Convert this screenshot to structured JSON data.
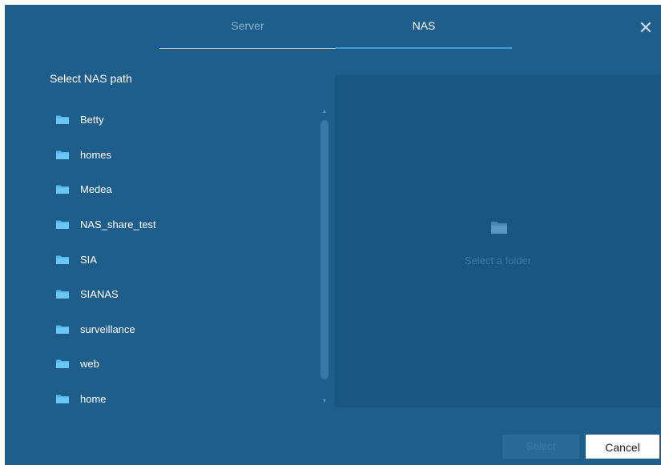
{
  "tabs": [
    {
      "label": "Server",
      "active": false
    },
    {
      "label": "NAS",
      "active": true
    }
  ],
  "close_icon": "close-icon",
  "left_panel": {
    "title": "Select NAS path",
    "folders": [
      {
        "label": "Betty",
        "icon": "folder-icon"
      },
      {
        "label": "homes",
        "icon": "folder-icon"
      },
      {
        "label": "Medea",
        "icon": "folder-icon"
      },
      {
        "label": "NAS_share_test",
        "icon": "folder-icon"
      },
      {
        "label": "SIA",
        "icon": "folder-icon"
      },
      {
        "label": "SIANAS",
        "icon": "folder-icon"
      },
      {
        "label": "surveillance",
        "icon": "folder-icon"
      },
      {
        "label": "web",
        "icon": "folder-icon"
      },
      {
        "label": "home",
        "icon": "folder-icon"
      }
    ]
  },
  "right_panel": {
    "empty_icon": "folder-open-icon",
    "empty_text": "Select a folder"
  },
  "footer": {
    "select_label": "Select",
    "cancel_label": "Cancel"
  },
  "colors": {
    "background": "#1f5d8b",
    "panel": "#1b5680",
    "accent": "#3b9be0",
    "folder": "#4fb6ee"
  }
}
